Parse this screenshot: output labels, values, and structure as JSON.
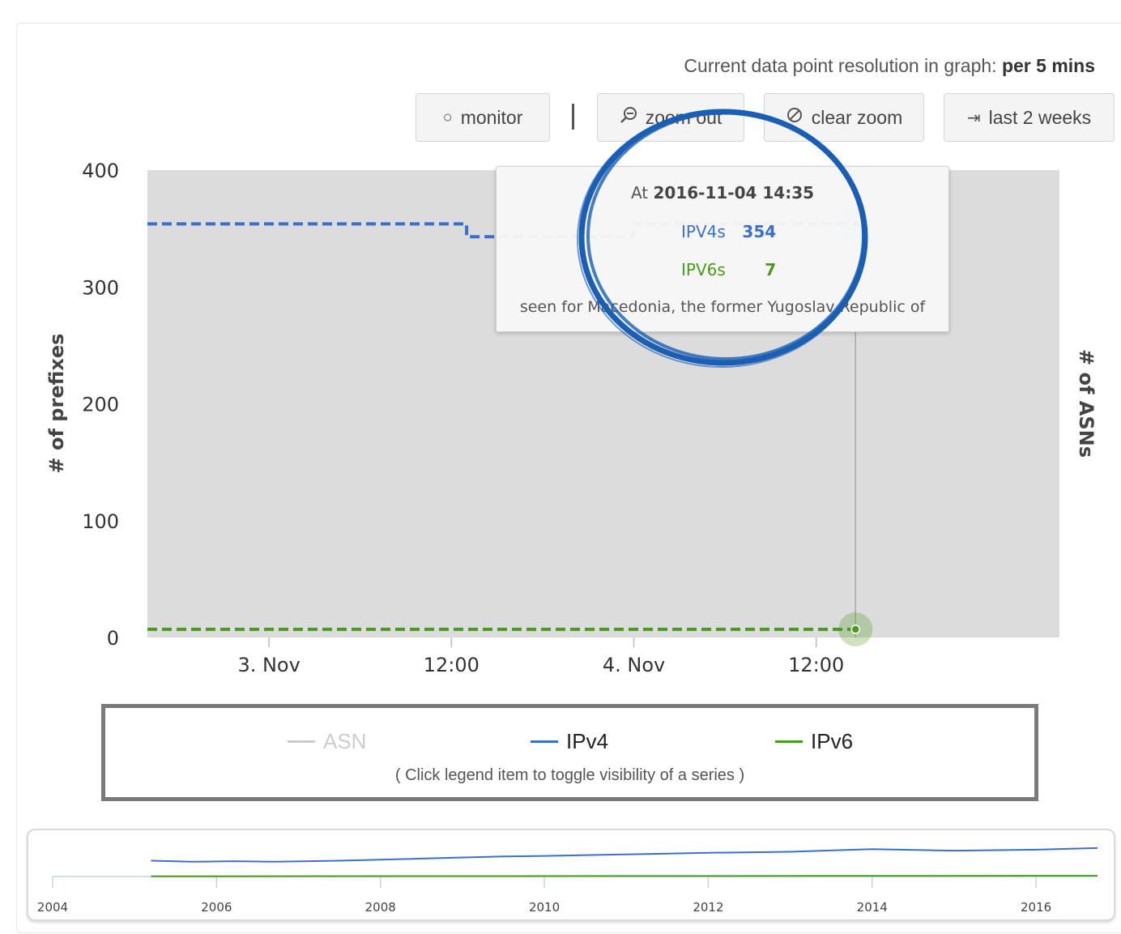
{
  "resolution": {
    "label": "Current data point resolution in graph:",
    "value": "per 5 mins"
  },
  "toolbar": {
    "monitor": {
      "icon": "circle-icon",
      "label": "monitor"
    },
    "zoom_out": {
      "icon": "zoom-out-icon",
      "label": "zoom out"
    },
    "clear_zoom": {
      "icon": "clear-zoom-icon",
      "label": "clear zoom"
    },
    "last_2_weeks": {
      "icon": "arrow-to-end-icon",
      "label": "last 2 weeks"
    }
  },
  "tooltip": {
    "at_label": "At",
    "timestamp": "2016-11-04 14:35",
    "rows": [
      {
        "label": "IPV4s",
        "value": "354"
      },
      {
        "label": "IPV6s",
        "value": "7"
      }
    ],
    "footer": "seen for Macedonia, the former Yugoslav Republic of"
  },
  "legend": {
    "items": [
      {
        "name": "ASN",
        "color": "#cccccc",
        "hidden": true
      },
      {
        "name": "IPv4",
        "color": "#3b6fcf",
        "hidden": false
      },
      {
        "name": "IPv6",
        "color": "#4a9a1c",
        "hidden": false
      }
    ],
    "hint": "( Click legend item to toggle visibility of a series )"
  },
  "colors": {
    "ipv4": "#3b6fcf",
    "ipv6": "#4a9a1c",
    "plot_bg": "#dcdcdc",
    "highlight": "#1a5fb4"
  },
  "chart_data": [
    {
      "type": "line",
      "ylabel": "# of prefixes",
      "y2label": "# of ASNs",
      "ylim": [
        0,
        400
      ],
      "yticks": [
        0,
        100,
        200,
        300,
        400
      ],
      "xlim": [
        "2016-11-02 16:00",
        "2016-11-05 04:00"
      ],
      "xticks": [
        {
          "value": "2016-11-03 00:00",
          "label": "3. Nov"
        },
        {
          "value": "2016-11-03 12:00",
          "label": "12:00"
        },
        {
          "value": "2016-11-04 00:00",
          "label": "4. Nov"
        },
        {
          "value": "2016-11-04 12:00",
          "label": "12:00"
        }
      ],
      "series": [
        {
          "name": "IPv4",
          "x": [
            "2016-11-02 16:00",
            "2016-11-03 12:00",
            "2016-11-03 13:00",
            "2016-11-03 23:00",
            "2016-11-04 00:00",
            "2016-11-04 14:35"
          ],
          "values": [
            354,
            354,
            343,
            343,
            354,
            354
          ]
        },
        {
          "name": "IPv6",
          "x": [
            "2016-11-02 16:00",
            "2016-11-04 14:35"
          ],
          "values": [
            7,
            7
          ]
        }
      ],
      "crosshair": "2016-11-04 14:35"
    },
    {
      "type": "line",
      "xlim": [
        2004,
        2016.75
      ],
      "xticks": [
        2004,
        2006,
        2008,
        2010,
        2012,
        2014,
        2016
      ],
      "ylim": [
        0,
        400
      ],
      "series": [
        {
          "name": "IPv4",
          "x": [
            2005.2,
            2005.7,
            2006.2,
            2006.7,
            2007.5,
            2008.5,
            2009.5,
            2010.0,
            2011.0,
            2012.0,
            2013.0,
            2014.0,
            2015.0,
            2016.0,
            2016.75
          ],
          "values": [
            150,
            140,
            145,
            140,
            150,
            170,
            190,
            195,
            210,
            225,
            235,
            260,
            245,
            255,
            270
          ]
        },
        {
          "name": "IPv6",
          "x": [
            2005.2,
            2016.75
          ],
          "values": [
            2,
            7
          ]
        }
      ]
    }
  ]
}
